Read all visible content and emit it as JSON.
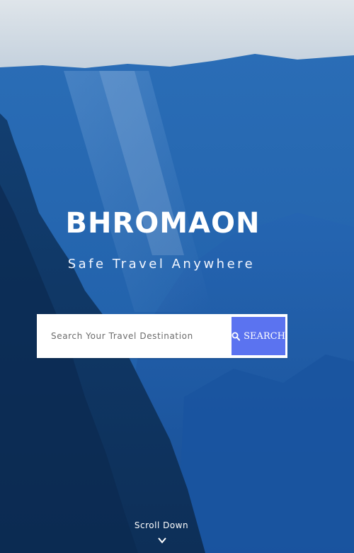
{
  "hero": {
    "brand_title": "BHROMAON",
    "tagline": "Safe Travel Anywhere"
  },
  "search": {
    "placeholder": "Search Your Travel Destination",
    "value": "",
    "button_label": "SEARCH",
    "button_icon": "search-icon",
    "accent_color": "#5b73f0"
  },
  "footer": {
    "scroll_label": "Scroll Down",
    "scroll_icon": "chevron-down-icon"
  }
}
